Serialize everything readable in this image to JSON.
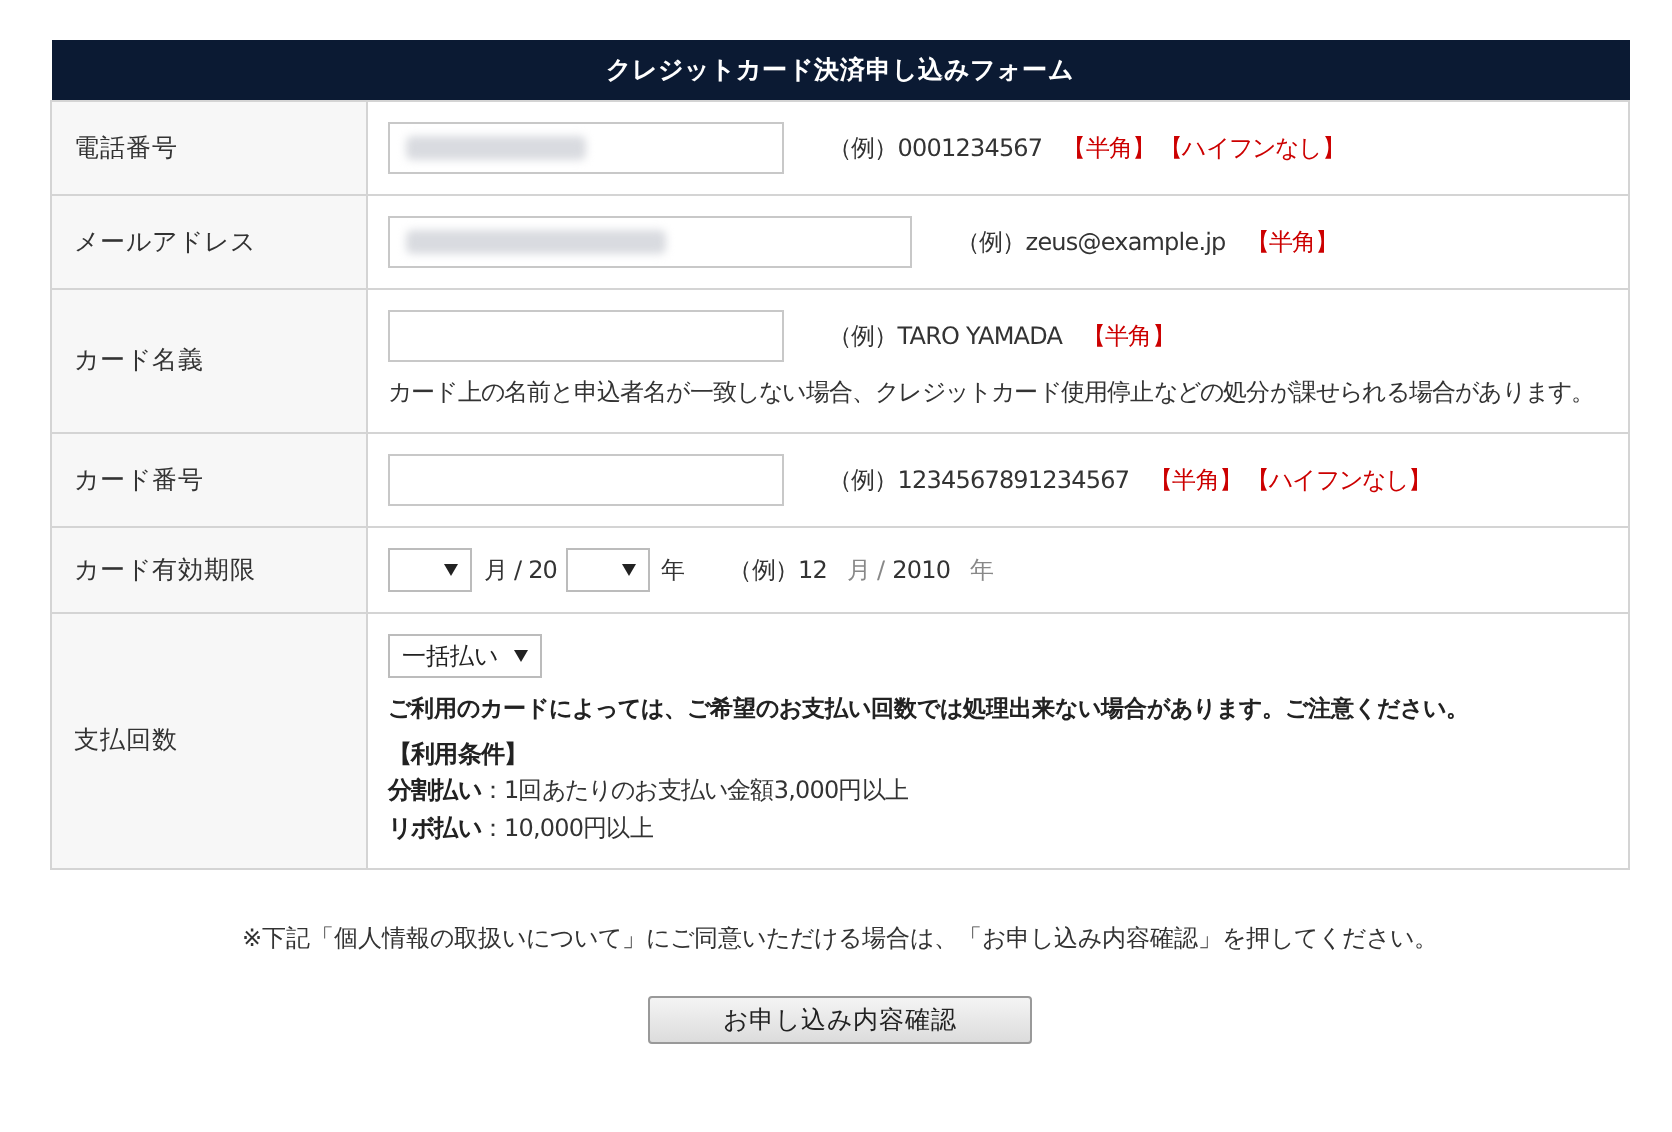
{
  "form_title": "クレジットカード決済申し込みフォーム",
  "rows": [
    {
      "kind": "text",
      "label": "電話番号",
      "field": {
        "wide": false,
        "redacted": true
      },
      "hint": [
        {
          "kind": "example",
          "text": "（例）0001234567"
        },
        {
          "kind": "tag",
          "text": "【半角】"
        },
        {
          "kind": "tag",
          "text": "【ハイフンなし】"
        }
      ]
    },
    {
      "kind": "text",
      "label": "メールアドレス",
      "field": {
        "wide": true,
        "redacted": true
      },
      "hint": [
        {
          "kind": "example",
          "text": "（例）zeus@example.jp"
        },
        {
          "kind": "tag",
          "text": "【半角】"
        }
      ]
    },
    {
      "kind": "text",
      "label": "カード名義",
      "field": {
        "wide": false,
        "redacted": false
      },
      "hint": [
        {
          "kind": "example",
          "text": "（例）TARO YAMADA"
        },
        {
          "kind": "tag",
          "text": "【半角】"
        }
      ],
      "note": "カード上の名前と申込者名が一致しない場合、クレジットカード使用停止などの処分が課せられる場合があります。"
    },
    {
      "kind": "text",
      "label": "カード番号",
      "field": {
        "wide": false,
        "redacted": false
      },
      "hint": [
        {
          "kind": "example",
          "text": "（例）1234567891234567"
        },
        {
          "kind": "tag",
          "text": "【半角】"
        },
        {
          "kind": "tag",
          "text": "【ハイフンなし】"
        }
      ]
    },
    {
      "kind": "expiry",
      "label": "カード有効期限",
      "month_unit": "月 / 20",
      "year_unit": "年",
      "hint": [
        {
          "kind": "example",
          "text": "（例）12"
        },
        {
          "kind": "muted",
          "text": "月 /"
        },
        {
          "kind": "example",
          "text": "2010"
        },
        {
          "kind": "muted",
          "text": "年"
        }
      ]
    },
    {
      "kind": "installments",
      "label": "支払回数",
      "select_value": "一括払い",
      "notice": "ご利用のカードによっては、ご希望のお支払い回数では処理出来ない場合があります。ご注意ください。",
      "conditions_title": "【利用条件】",
      "conditions": [
        "**分割払い**：1回あたりのお支払い金額3,000円以上",
        "**リボ払い**：10,000円以上"
      ]
    }
  ],
  "consent_note": "※下記「個人情報の取扱いについて」にご同意いただける場合は、「お申し込み内容確認」を押してください。",
  "submit_button": "お申し込み内容確認"
}
